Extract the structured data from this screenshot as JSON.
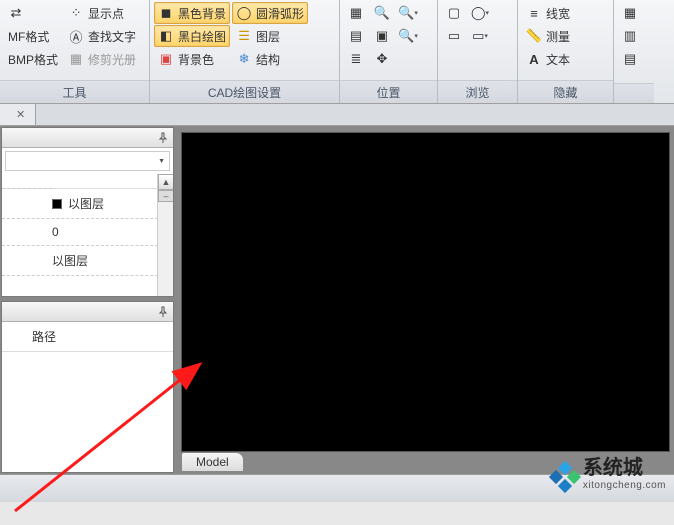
{
  "ribbon": {
    "groups": {
      "tools": {
        "title": "工具",
        "show_points": "显示点",
        "emf_format": "MF格式",
        "find_text": "查找文字",
        "bmp_format": "BMP格式",
        "trim_album": "修剪光册"
      },
      "cad": {
        "title": "CAD绘图设置",
        "black_bg": "黑色背景",
        "smooth_arc": "圆滑弧形",
        "bw_draw": "黑白绘图",
        "layers": "图层",
        "bg_color": "背景色",
        "structure": "结构"
      },
      "position": {
        "title": "位置"
      },
      "browse": {
        "title": "浏览"
      },
      "hide": {
        "title": "隐藏",
        "linewidth": "线宽",
        "measure": "测量",
        "text": "文本"
      }
    }
  },
  "doc_tab": {
    "label": ""
  },
  "properties": {
    "rows": {
      "by_layer_color": "以图层",
      "zero": "0",
      "by_layer_lt": "以图层"
    }
  },
  "panel2": {
    "header": "路径"
  },
  "model_tab": "Model",
  "watermark": {
    "cn": "系统城",
    "en": "xitongcheng.com"
  }
}
